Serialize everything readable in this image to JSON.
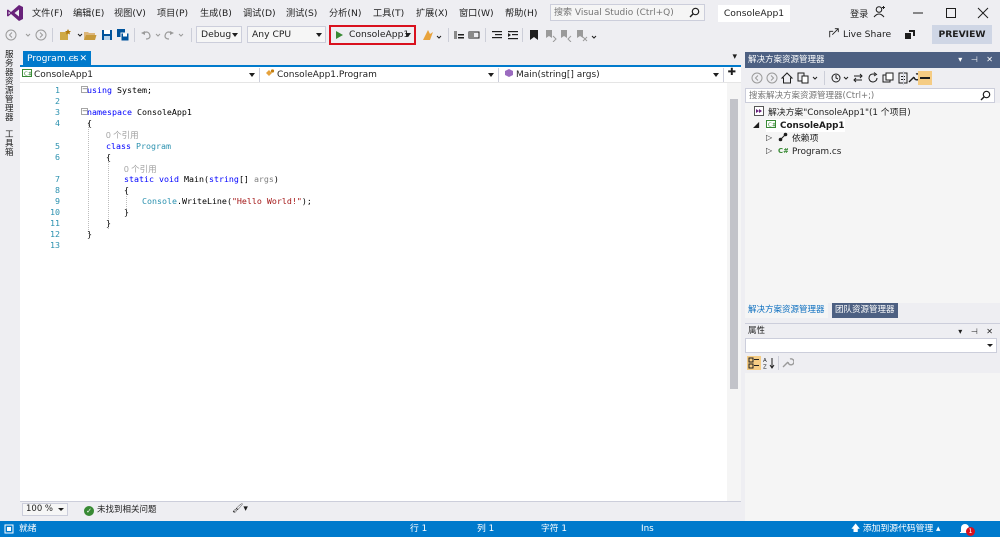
{
  "menu": {
    "items": [
      "文件(F)",
      "编辑(E)",
      "视图(V)",
      "项目(P)",
      "生成(B)",
      "调试(D)",
      "测试(S)",
      "分析(N)",
      "工具(T)",
      "扩展(X)",
      "窗口(W)",
      "帮助(H)"
    ]
  },
  "search": {
    "placeholder": "搜索 Visual Studio (Ctrl+Q)"
  },
  "solution_title": "ConsoleApp1",
  "account": {
    "signin_label": "登录"
  },
  "toolbar": {
    "configuration": "Debug",
    "platform": "Any CPU",
    "start_label": "ConsoleApp1",
    "liveshare_label": "Live Share",
    "preview_label": "PREVIEW"
  },
  "left_strip": {
    "tabs": [
      "服务器资源管理器",
      "工具箱"
    ]
  },
  "document": {
    "tab_label": "Program.cs",
    "nav": {
      "project": "ConsoleApp1",
      "type": "ConsoleApp1.Program",
      "member": "Main(string[] args)"
    },
    "line_numbers": [
      "1",
      "2",
      "3",
      "4",
      "5",
      "6",
      "7",
      "8",
      "9",
      "10",
      "11",
      "12",
      "13"
    ],
    "code": {
      "l1_kw": "using",
      "l1_rest": " System;",
      "l3_kw": "namespace",
      "l3_rest": " ConsoleApp1",
      "l4": "{",
      "lens1": "0 个引用",
      "l5_kw": "class",
      "l5_type": " Program",
      "l6": "{",
      "lens2": "0 个引用",
      "l7_kw1": "static",
      "l7_kw2": " void",
      "l7_name": " Main",
      "l7_paren": "(",
      "l7_kw3": "string",
      "l7_mid": "[] ",
      "l7_param": "args",
      "l7_end": ")",
      "l8": "{",
      "l9_type": "Console",
      "l9_dot": ".",
      "l9_method": "WriteLine",
      "l9_open": "(",
      "l9_str": "\"Hello World!\"",
      "l9_close": ");",
      "l10": "}",
      "l11": "}",
      "l12": "}"
    }
  },
  "editor_status": {
    "zoom": "100 %",
    "issues": "未找到相关问题"
  },
  "solution_explorer": {
    "title": "解决方案资源管理器",
    "search_placeholder": "搜索解决方案资源管理器(Ctrl+;)",
    "tree": {
      "solution": "解决方案\"ConsoleApp1\"(1 个项目)",
      "project": "ConsoleApp1",
      "dependencies": "依赖项",
      "file": "Program.cs"
    },
    "tabs": [
      "解决方案资源管理器",
      "团队资源管理器"
    ]
  },
  "properties": {
    "title": "属性"
  },
  "statusbar": {
    "ready": "就绪",
    "line": "行 1",
    "col": "列 1",
    "char": "字符 1",
    "mode": "Ins",
    "source_control": "添加到源代码管理",
    "notification_count": "1"
  },
  "colors": {
    "accent": "#007acc",
    "panel_title": "#4d6082",
    "start_highlight": "#d9111e",
    "keyword": "#0000ff",
    "type": "#2b91af",
    "string": "#a31515",
    "vs_purple": "#68217a"
  },
  "icons": [
    "vs-logo-icon",
    "search-icon",
    "user-icon",
    "minimize-icon",
    "maximize-icon",
    "close-icon",
    "back-icon",
    "forward-icon",
    "new-project-icon",
    "open-icon",
    "save-icon",
    "save-all-icon",
    "undo-icon",
    "redo-icon",
    "play-icon",
    "liveshare-icon",
    "feedback-icon",
    "home-icon",
    "sync-icon",
    "settings-icon",
    "wrench-icon",
    "bell-icon",
    "checkmark-icon"
  ]
}
